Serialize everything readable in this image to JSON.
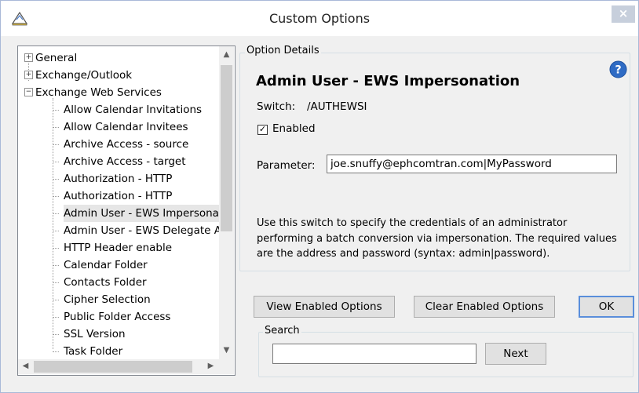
{
  "window": {
    "title": "Custom Options",
    "close_label": "×"
  },
  "tree": {
    "nodes": [
      {
        "label": "General",
        "expander": "+"
      },
      {
        "label": "Exchange/Outlook",
        "expander": "+"
      },
      {
        "label": "Exchange Web Services",
        "expander": "−"
      }
    ],
    "children": [
      "Allow Calendar Invitations",
      "Allow Calendar Invitees",
      "Archive Access - source",
      "Archive Access - target",
      "Authorization - HTTP",
      "Authorization - HTTP",
      "Admin User - EWS Impersonation",
      "Admin User - EWS Delegate Access",
      "HTTP Header enable",
      "Calendar Folder",
      "Contacts Folder",
      "Cipher Selection",
      "Public Folder Access",
      "SSL Version",
      "Task Folder"
    ],
    "selected_child": "Admin User - EWS Impersonation"
  },
  "details": {
    "group_label": "Option Details",
    "title": "Admin User - EWS Impersonation",
    "switch_label": "Switch:",
    "switch_value": "/AUTHEWSI",
    "enabled_label": "Enabled",
    "enabled": true,
    "parameter_label": "Parameter:",
    "parameter_value": "joe.snuffy@ephcomtran.com|MyPassword",
    "description": "Use this switch to specify the credentials of an administrator performing a batch conversion via impersonation. The required values are the address and password (syntax: admin|password).",
    "help_icon": "question-circle-icon"
  },
  "buttons": {
    "view_enabled": "View Enabled Options",
    "clear_enabled": "Clear Enabled Options",
    "ok": "OK"
  },
  "search": {
    "group_label": "Search",
    "value": "",
    "next_label": "Next"
  }
}
